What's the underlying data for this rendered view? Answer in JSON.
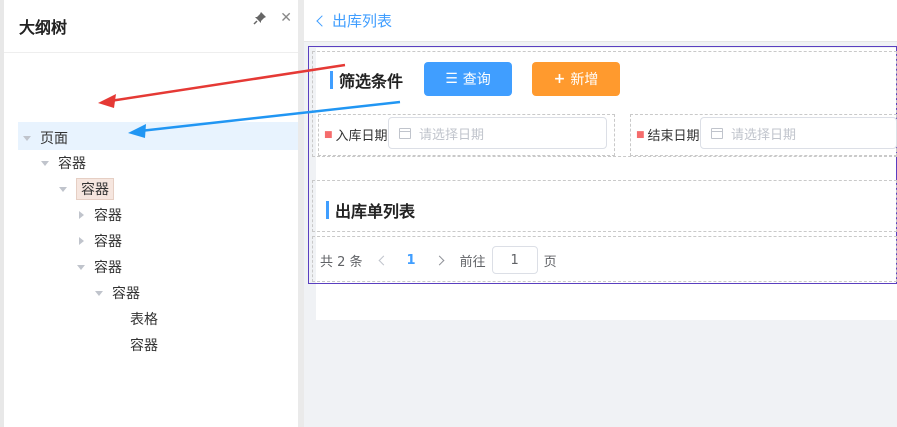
{
  "outline": {
    "title": "大纲树",
    "tree": [
      {
        "label": "页面"
      },
      {
        "label": "容器"
      },
      {
        "label": "容器"
      },
      {
        "label": "容器"
      },
      {
        "label": "容器"
      },
      {
        "label": "容器"
      },
      {
        "label": "容器"
      },
      {
        "label": "表格"
      },
      {
        "label": "容器"
      }
    ]
  },
  "topbar": {
    "back_label": "出库列表"
  },
  "filter": {
    "title": "筛选条件",
    "query_label": "查询",
    "add_label": "新增",
    "in_date_label": "入库日期",
    "in_date_placeholder": "请选择日期",
    "end_date_label": "结束日期",
    "end_date_placeholder": "请选择日期"
  },
  "list": {
    "title": "出库单列表"
  },
  "pagination": {
    "total_text": "共 2 条",
    "current_page": "1",
    "goto_label": "前往",
    "goto_value": "1",
    "page_suffix": "页"
  },
  "colors": {
    "accent": "#409eff",
    "add_button": "#ff9a2e",
    "selection_border": "#5a3fc0",
    "arrow_red": "#e53935",
    "arrow_blue": "#2196f3"
  }
}
